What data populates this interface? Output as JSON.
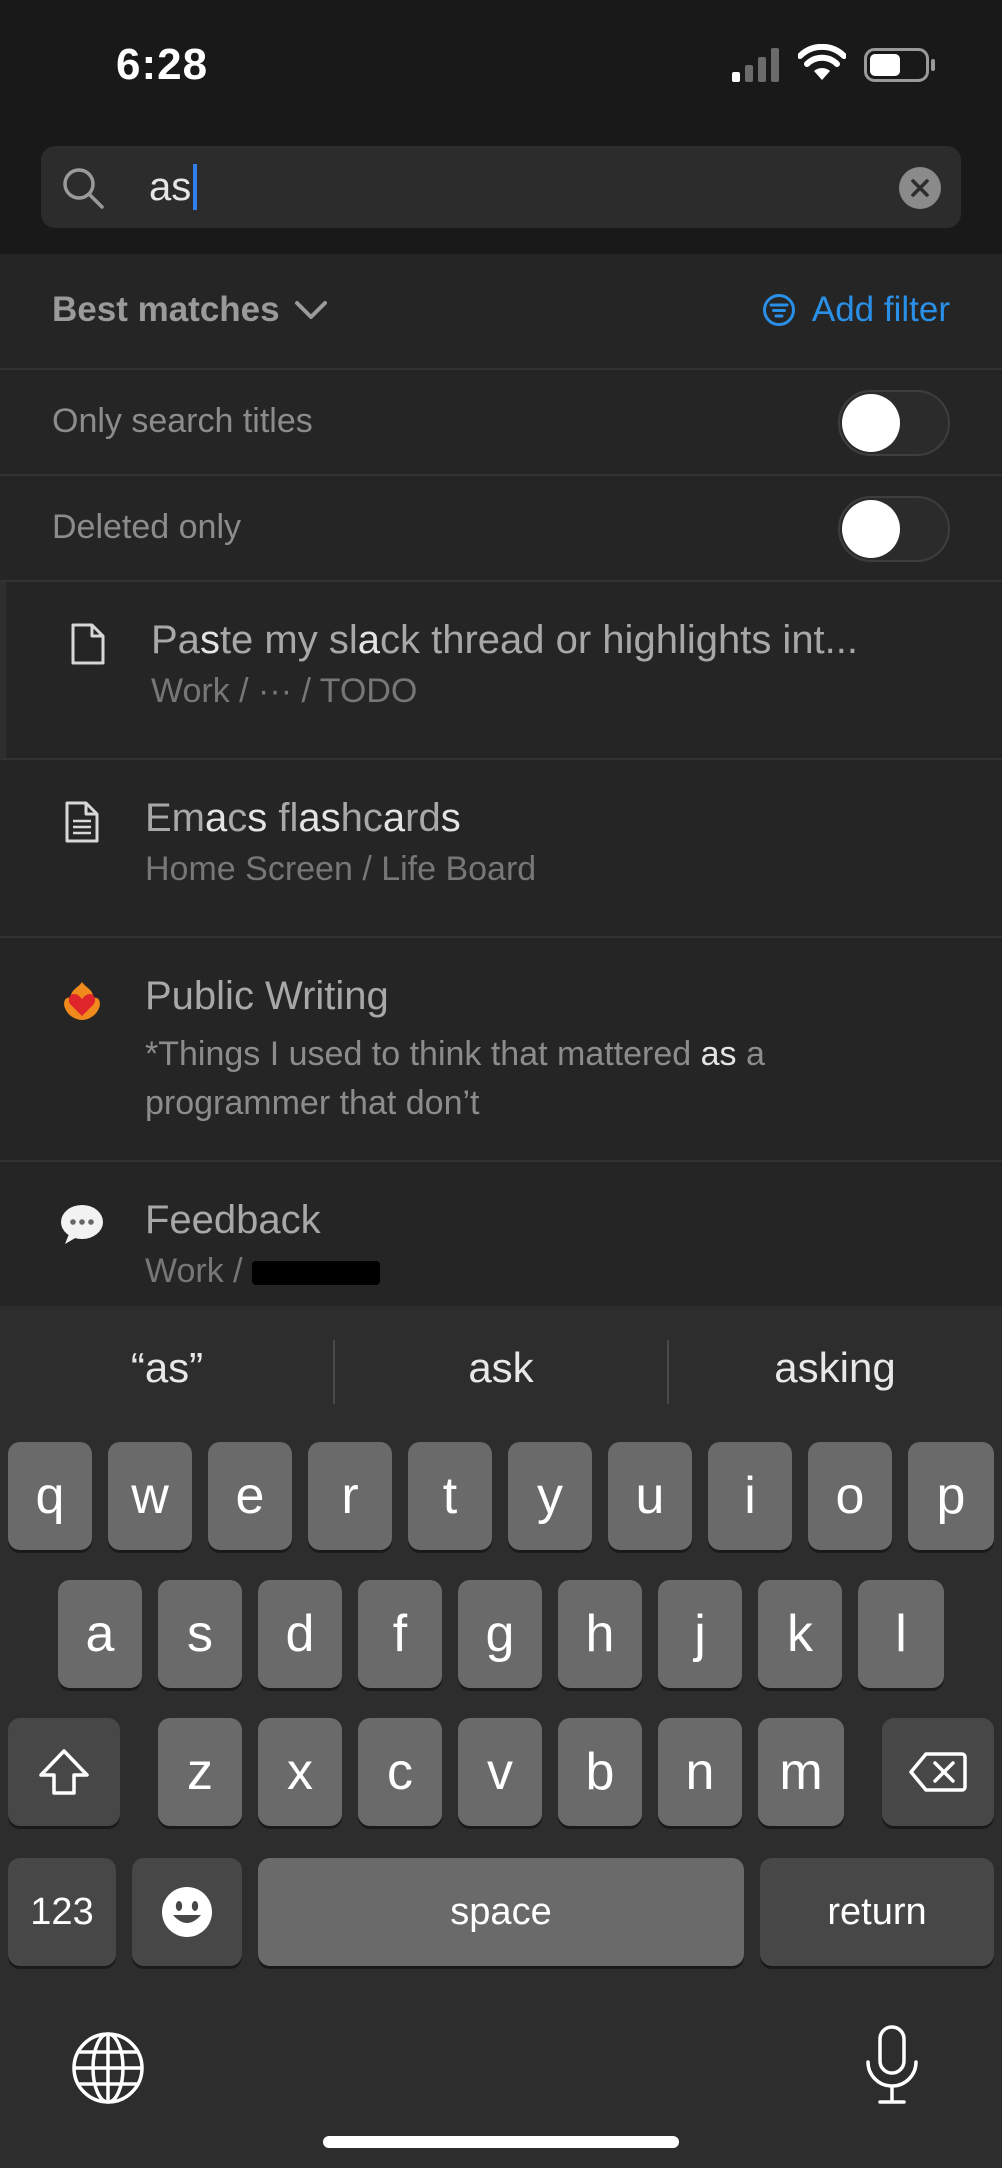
{
  "status_bar": {
    "time": "6:28"
  },
  "search": {
    "query": "as"
  },
  "filters": {
    "sort_label": "Best matches",
    "add_filter_label": "Add filter",
    "only_titles_label": "Only search titles",
    "only_titles_on": false,
    "deleted_only_label": "Deleted only",
    "deleted_only_on": false
  },
  "results": [
    {
      "icon": "page-icon",
      "title_parts": [
        "Pa",
        "s",
        "te my sl",
        "a",
        "ck thread or highlights int..."
      ],
      "subtitle": "Work / ··· / TODO"
    },
    {
      "icon": "document-lines-icon",
      "title_parts": [
        "Em",
        "a",
        "c",
        "s",
        " fl",
        "as",
        "hc",
        "a",
        "rd",
        "s",
        ""
      ],
      "subtitle": "Home Screen / Life Board"
    },
    {
      "icon": "heart-on-fire-emoji-icon",
      "title": "Public Writing",
      "snippet_before": "*Things I used to think that mattered ",
      "snippet_match": "as",
      "snippet_after": " a programmer that don’t"
    },
    {
      "icon": "speech-bubble-emoji-icon",
      "title": "Feedback",
      "subtitle": "Work / "
    }
  ],
  "keyboard": {
    "suggestions": [
      "“as”",
      "ask",
      "asking"
    ],
    "row1": [
      "q",
      "w",
      "e",
      "r",
      "t",
      "y",
      "u",
      "i",
      "o",
      "p"
    ],
    "row2": [
      "a",
      "s",
      "d",
      "f",
      "g",
      "h",
      "j",
      "k",
      "l"
    ],
    "row3": [
      "z",
      "x",
      "c",
      "v",
      "b",
      "n",
      "m"
    ],
    "numbers_label": "123",
    "space_label": "space",
    "return_label": "return"
  },
  "colors": {
    "accent": "#2a8fe6",
    "caret": "#2f80ed"
  }
}
